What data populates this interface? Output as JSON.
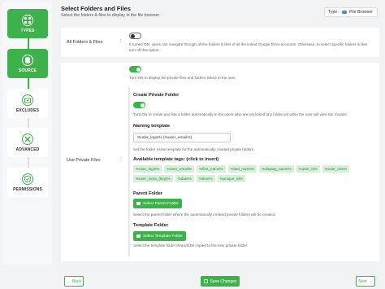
{
  "header": {
    "title": "Select Folders and Files",
    "subtitle": "Select the folders & files to display in the file browser.",
    "type_label": "Type :",
    "type_value": "File Browser"
  },
  "steps": [
    {
      "label": "TYPES",
      "icon": "grid-icon",
      "active": true
    },
    {
      "label": "SOURCE",
      "icon": "database-icon",
      "active": true
    },
    {
      "label": "EXCLUDES",
      "icon": "folder-minus-icon",
      "active": false
    },
    {
      "label": "ADVANCED",
      "icon": "tools-icon",
      "active": false
    },
    {
      "label": "PERMISSIONS",
      "icon": "shield-check-icon",
      "active": false
    }
  ],
  "all_folders": {
    "label": "All Folders & Files",
    "toggle_on": false,
    "description": "If turned ON, users can navigate through all the folders & files of all the linked Google Drive accounts. Otherwise, to select specific folders & files turn off this option."
  },
  "private_files": {
    "label": "Use Private Files",
    "toggle_on": true,
    "description": "Turn ON to display the private files and folders linked to the user.",
    "create_private_folder": {
      "title": "Create Private Folder",
      "toggle_on": true,
      "description": "Turn ON to create and link a folder automatically to the users who are not linked any folder yet while the user will view the module."
    },
    "naming_template": {
      "title": "Naming template",
      "value": "%user_login% (%user_email%)",
      "description": "Set the folder name template for the automatically created private folders."
    },
    "tags_title": "Available template tags: (click to insert)",
    "tags": [
      "%user_login%",
      "%user_email%",
      "%first_name%",
      "%last_name%",
      "%display_name%",
      "%user_id%",
      "%user_role%",
      "%user_meta_{key}%",
      "%date%",
      "%time%",
      "%unique_id%"
    ],
    "parent_folder": {
      "title": "Parent Folder",
      "button": "Select Parent Folder",
      "description": "Select the parent folder where the automatically created private folders will be created."
    },
    "template_folder": {
      "title": "Template Folder",
      "button": "Select Template Folder",
      "description": "Select the template folder that will be copied to the new private folder."
    }
  },
  "footer": {
    "back": "Back",
    "save": "Save Changes",
    "next": "Next"
  },
  "colors": {
    "accent": "#3db24a"
  }
}
